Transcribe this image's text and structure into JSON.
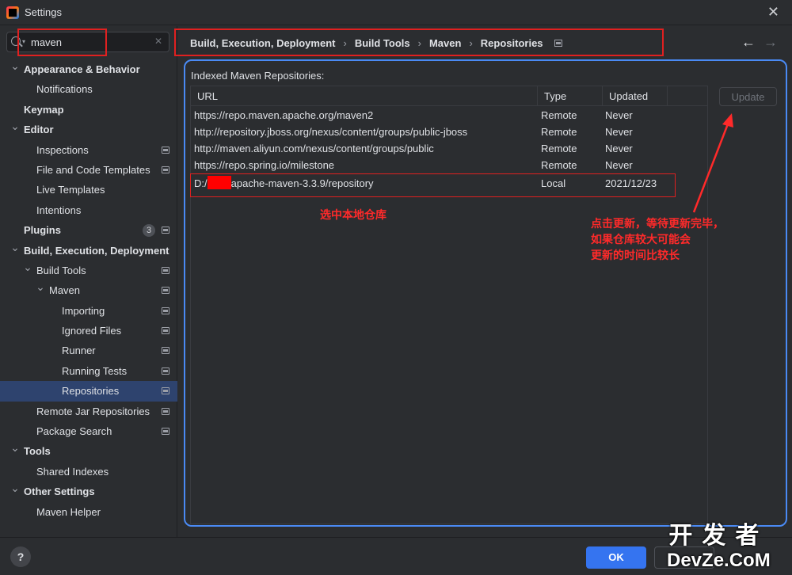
{
  "window": {
    "title": "Settings"
  },
  "search": {
    "value": "maven"
  },
  "sidebar": {
    "items": [
      {
        "label": "Appearance & Behavior",
        "bold": true,
        "chevron": "down",
        "level": 0
      },
      {
        "label": "Notifications",
        "bold": false,
        "chevron": "",
        "level": 1
      },
      {
        "label": "Keymap",
        "bold": true,
        "chevron": "",
        "level": 0
      },
      {
        "label": "Editor",
        "bold": true,
        "chevron": "down",
        "level": 0
      },
      {
        "label": "Inspections",
        "bold": false,
        "chevron": "",
        "level": 1,
        "project": true
      },
      {
        "label": "File and Code Templates",
        "bold": false,
        "chevron": "",
        "level": 1,
        "project": true
      },
      {
        "label": "Live Templates",
        "bold": false,
        "chevron": "",
        "level": 1
      },
      {
        "label": "Intentions",
        "bold": false,
        "chevron": "",
        "level": 1
      },
      {
        "label": "Plugins",
        "bold": true,
        "chevron": "",
        "level": 0,
        "badge": "3",
        "project": true
      },
      {
        "label": "Build, Execution, Deployment",
        "bold": true,
        "chevron": "down",
        "level": 0
      },
      {
        "label": "Build Tools",
        "bold": false,
        "chevron": "down",
        "level": 1,
        "project": true
      },
      {
        "label": "Maven",
        "bold": false,
        "chevron": "down",
        "level": 2,
        "project": true
      },
      {
        "label": "Importing",
        "bold": false,
        "chevron": "",
        "level": 3,
        "project": true
      },
      {
        "label": "Ignored Files",
        "bold": false,
        "chevron": "",
        "level": 3,
        "project": true
      },
      {
        "label": "Runner",
        "bold": false,
        "chevron": "",
        "level": 3,
        "project": true
      },
      {
        "label": "Running Tests",
        "bold": false,
        "chevron": "",
        "level": 3,
        "project": true
      },
      {
        "label": "Repositories",
        "bold": false,
        "chevron": "",
        "level": 3,
        "project": true,
        "selected": true
      },
      {
        "label": "Remote Jar Repositories",
        "bold": false,
        "chevron": "",
        "level": 1,
        "project": true
      },
      {
        "label": "Package Search",
        "bold": false,
        "chevron": "",
        "level": 1,
        "project": true
      },
      {
        "label": "Tools",
        "bold": true,
        "chevron": "down",
        "level": 0
      },
      {
        "label": "Shared Indexes",
        "bold": false,
        "chevron": "",
        "level": 1
      },
      {
        "label": "Other Settings",
        "bold": true,
        "chevron": "down",
        "level": 0
      },
      {
        "label": "Maven Helper",
        "bold": false,
        "chevron": "",
        "level": 1
      }
    ]
  },
  "breadcrumb": [
    "Build, Execution, Deployment",
    "Build Tools",
    "Maven",
    "Repositories"
  ],
  "main": {
    "section_label": "Indexed Maven Repositories:",
    "columns": [
      "URL",
      "Type",
      "Updated"
    ],
    "rows": [
      {
        "url": "https://repo.maven.apache.org/maven2",
        "type": "Remote",
        "updated": "Never"
      },
      {
        "url": "http://repository.jboss.org/nexus/content/groups/public-jboss",
        "type": "Remote",
        "updated": "Never"
      },
      {
        "url": "http://maven.aliyun.com/nexus/content/groups/public",
        "type": "Remote",
        "updated": "Never"
      },
      {
        "url": "https://repo.spring.io/milestone",
        "type": "Remote",
        "updated": "Never"
      },
      {
        "url_prefix": "D:/",
        "url": "apache-maven-3.3.9/repository",
        "type": "Local",
        "updated": "2021/12/23",
        "redacted": true
      }
    ],
    "update_label": "Update"
  },
  "annotations": {
    "select_local": "选中本地仓库",
    "update_note": [
      "点击更新，等待更新完毕，",
      "如果仓库较大可能会",
      "更新的时间比较长"
    ]
  },
  "footer": {
    "ok_label": "OK",
    "help_label": "?"
  },
  "watermark": {
    "top": "开发者",
    "bottom": "DevZe.CoM"
  },
  "colors": {
    "accent": "#3574f0",
    "selection": "#2e436e",
    "annotation_red": "#ff2a2a",
    "frame_blue": "#4a8af4"
  }
}
